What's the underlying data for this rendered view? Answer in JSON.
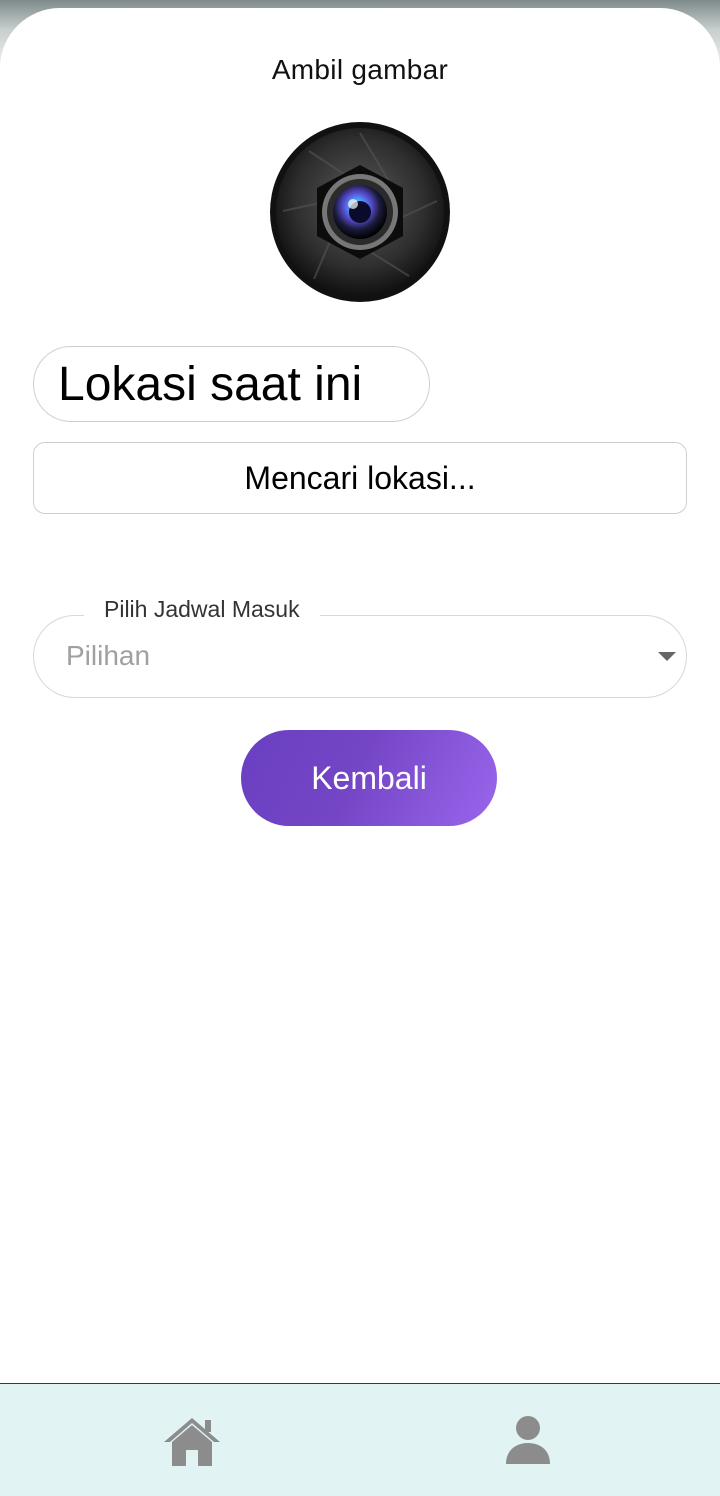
{
  "camera": {
    "title": "Ambil gambar",
    "icon": "camera-lens-icon"
  },
  "location": {
    "label": "Lokasi saat ini",
    "status": "Mencari lokasi..."
  },
  "schedule": {
    "legend": "Pilih Jadwal Masuk",
    "placeholder": "Pilihan",
    "icon": "chevron-down-icon"
  },
  "actions": {
    "back_label": "Kembali"
  },
  "bottom_nav": {
    "items": [
      {
        "name": "home",
        "icon": "home-icon"
      },
      {
        "name": "profile",
        "icon": "user-icon"
      }
    ]
  },
  "colors": {
    "accent_start": "#6a3fc1",
    "accent_end": "#9a66ec",
    "nav_background": "#e2f3f3",
    "nav_icon": "#8c8c8c"
  }
}
